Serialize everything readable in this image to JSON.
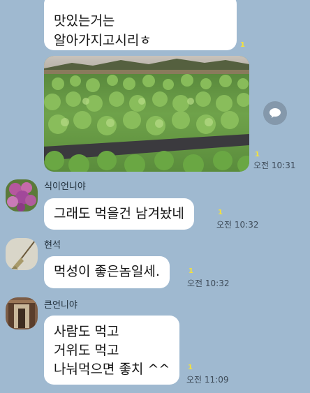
{
  "messages": [
    {
      "lines": [
        "맛있는거는",
        "알아가지고시리ㅎ"
      ],
      "unread": "1"
    },
    {
      "type": "photo",
      "image": "cabbage-field-photo",
      "unread": "1",
      "time": "오전 10:31"
    },
    {
      "sender": "식이언니야",
      "avatar": "purple-flowers-avatar",
      "text": "그래도 먹을건 남겨놨네",
      "unread": "1",
      "time": "오전 10:32"
    },
    {
      "sender": "현석",
      "avatar": "broom-avatar",
      "text": "먹성이 좋은놈일세.",
      "unread": "1",
      "time": "오전 10:32"
    },
    {
      "sender": "큰언니야",
      "avatar": "doorway-avatar",
      "lines": [
        "사람도 먹고",
        "거위도 먹고",
        "나눠먹으면 좋치 ^^"
      ],
      "unread": "1",
      "time": "오전 11:09"
    }
  ],
  "icons": {
    "share": "share-chat-icon"
  },
  "colors": {
    "background": "#9fb9d0",
    "bubble": "#ffffff",
    "unread": "#f5e23a"
  }
}
